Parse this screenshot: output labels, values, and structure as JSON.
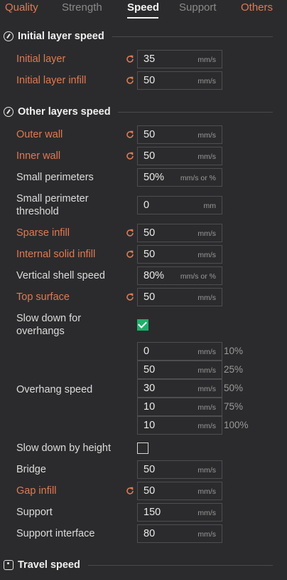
{
  "tabs": [
    "Quality",
    "Strength",
    "Speed",
    "Support",
    "Others"
  ],
  "sections": {
    "initial": "Initial layer speed",
    "other": "Other layers speed",
    "travel": "Travel speed"
  },
  "rows": {
    "initial_layer": {
      "label": "Initial layer",
      "value": "35",
      "unit": "mm/s"
    },
    "initial_layer_infill": {
      "label": "Initial layer infill",
      "value": "50",
      "unit": "mm/s"
    },
    "outer_wall": {
      "label": "Outer wall",
      "value": "50",
      "unit": "mm/s"
    },
    "inner_wall": {
      "label": "Inner wall",
      "value": "50",
      "unit": "mm/s"
    },
    "small_perimeters": {
      "label": "Small perimeters",
      "value": "50%",
      "unit": "mm/s or %"
    },
    "small_perimeter_threshold": {
      "label_line1": "Small perimeter",
      "label_line2": "threshold",
      "value": "0",
      "unit": "mm"
    },
    "sparse_infill": {
      "label": "Sparse infill",
      "value": "50",
      "unit": "mm/s"
    },
    "internal_solid_infill": {
      "label": "Internal solid infill",
      "value": "50",
      "unit": "mm/s"
    },
    "vertical_shell_speed": {
      "label": "Vertical shell speed",
      "value": "80%",
      "unit": "mm/s or %"
    },
    "top_surface": {
      "label": "Top surface",
      "value": "50",
      "unit": "mm/s"
    },
    "slow_down_overhangs": {
      "label_line1": "Slow down for",
      "label_line2": "overhangs",
      "checked": true
    },
    "overhang_speed": {
      "label": "Overhang speed",
      "items": [
        {
          "value": "0",
          "unit": "mm/s",
          "pct": "10%"
        },
        {
          "value": "50",
          "unit": "mm/s",
          "pct": "25%"
        },
        {
          "value": "30",
          "unit": "mm/s",
          "pct": "50%"
        },
        {
          "value": "10",
          "unit": "mm/s",
          "pct": "75%"
        },
        {
          "value": "10",
          "unit": "mm/s",
          "pct": "100%"
        }
      ]
    },
    "slow_down_by_height": {
      "label": "Slow down by height",
      "checked": false
    },
    "bridge": {
      "label": "Bridge",
      "value": "50",
      "unit": "mm/s"
    },
    "gap_infill": {
      "label": "Gap infill",
      "value": "50",
      "unit": "mm/s"
    },
    "support": {
      "label": "Support",
      "value": "150",
      "unit": "mm/s"
    },
    "support_interface": {
      "label": "Support interface",
      "value": "80",
      "unit": "mm/s"
    }
  },
  "colors": {
    "modified": "#e07a52",
    "checkbox": "#1fae6b",
    "background": "#2b2b2d"
  }
}
